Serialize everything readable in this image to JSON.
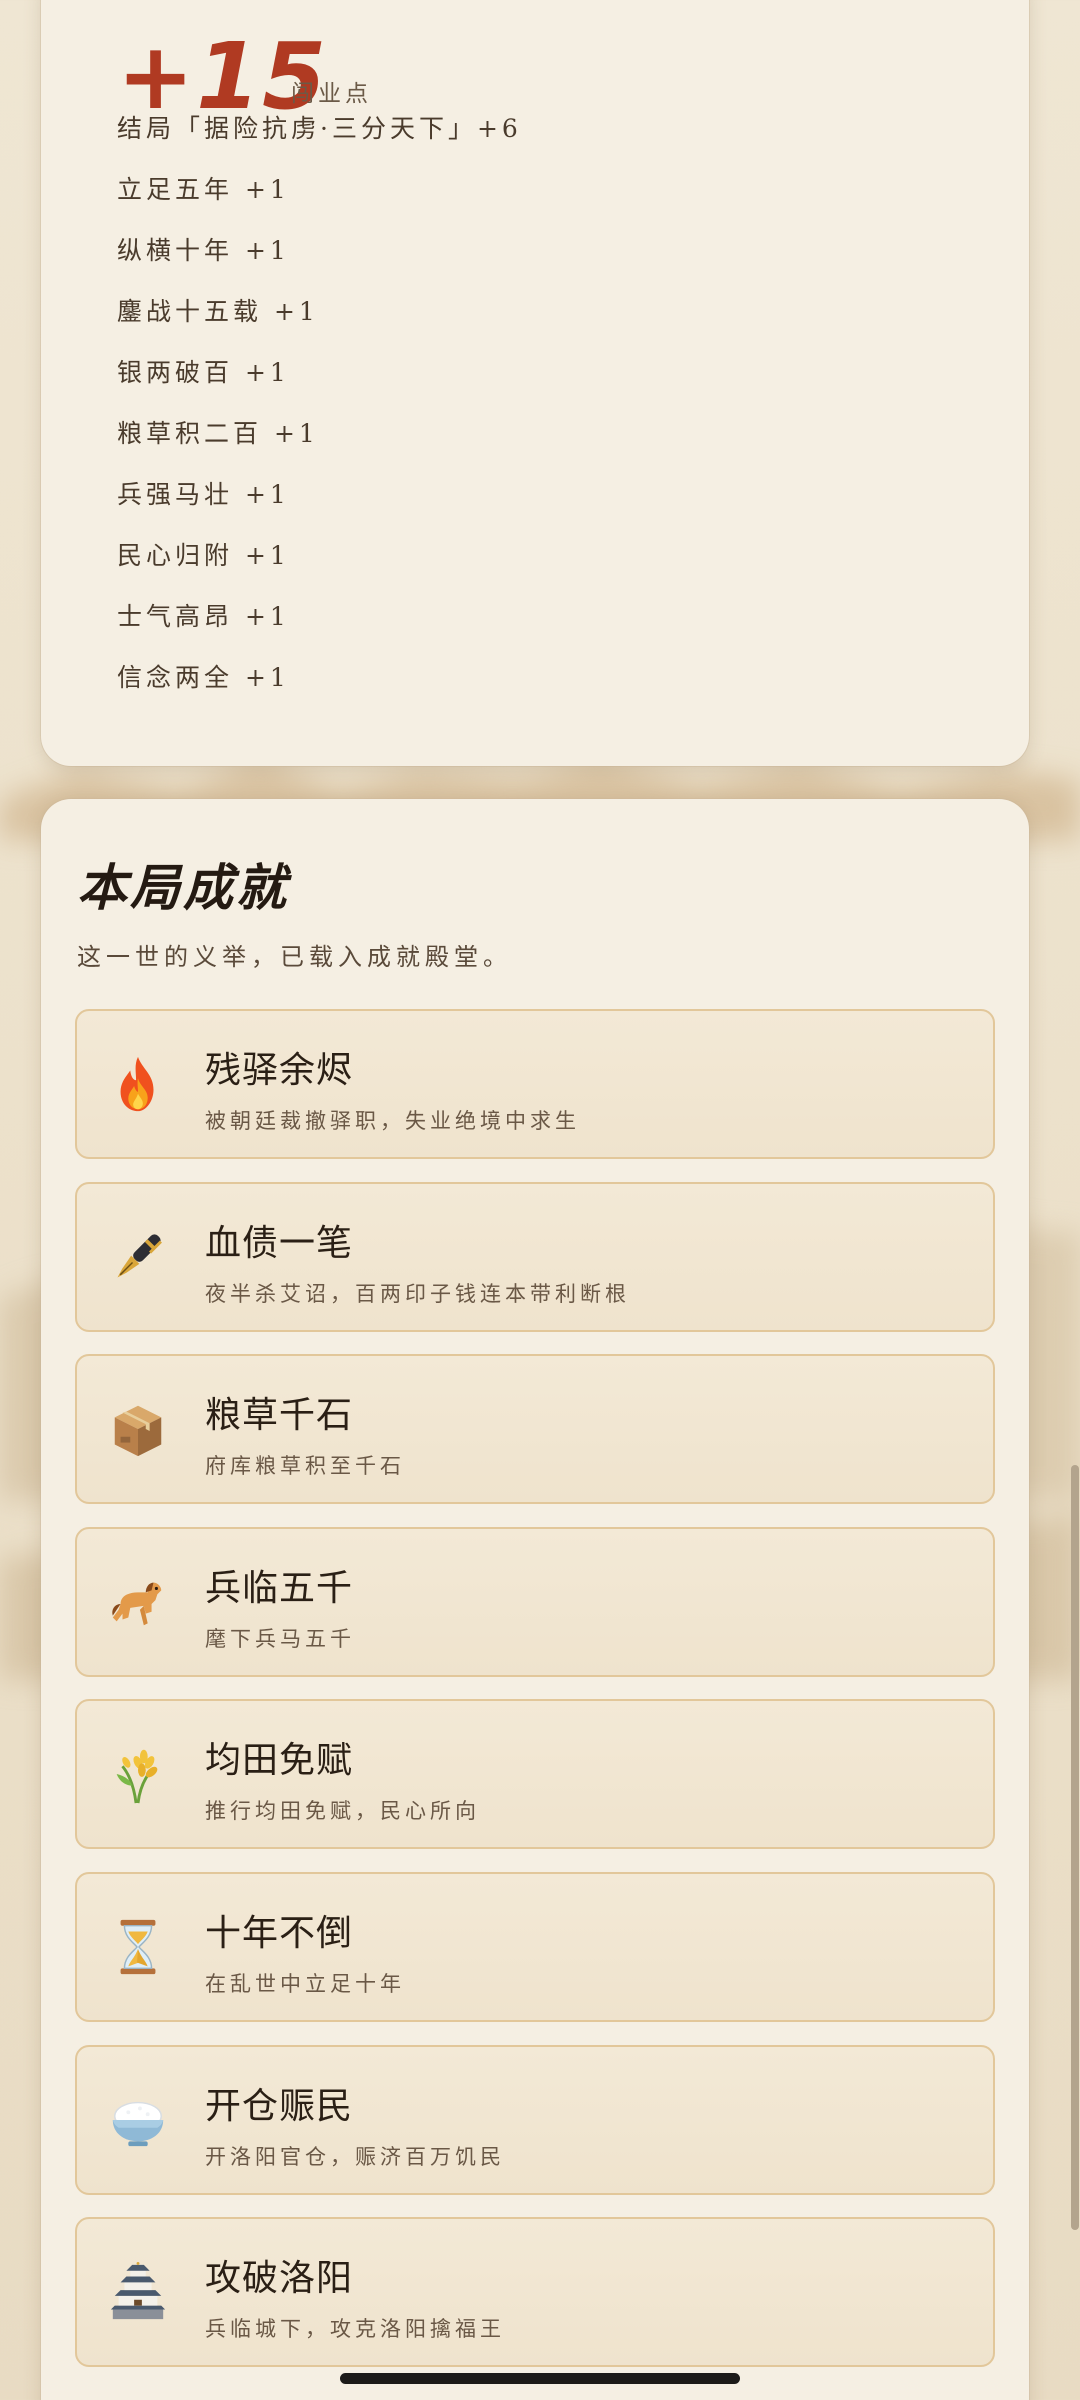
{
  "score": {
    "value": "+15",
    "label": "闯业点",
    "color": "#b03a22"
  },
  "bonuses": [
    "结局「据险抗虏·三分天下」+6",
    "立足五年 +1",
    "纵横十年 +1",
    "鏖战十五载 +1",
    "银两破百 +1",
    "粮草积二百 +1",
    "兵强马壮 +1",
    "民心归附 +1",
    "士气高昂 +1",
    "信念两全 +1"
  ],
  "achievements": {
    "title": "本局成就",
    "subtitle": "这一世的义举，已载入成就殿堂。",
    "items": [
      {
        "name": "残驿余烬",
        "desc": "被朝廷裁撤驿职，失业绝境中求生",
        "icon": "fire-icon"
      },
      {
        "name": "血债一笔",
        "desc": "夜半杀艾诏，百两印子钱连本带利断根",
        "icon": "pen-icon"
      },
      {
        "name": "粮草千石",
        "desc": "府库粮草积至千石",
        "icon": "box-icon"
      },
      {
        "name": "兵临五千",
        "desc": "麾下兵马五千",
        "icon": "horse-icon"
      },
      {
        "name": "均田免赋",
        "desc": "推行均田免赋，民心所向",
        "icon": "rice-icon"
      },
      {
        "name": "十年不倒",
        "desc": "在乱世中立足十年",
        "icon": "hourglass-icon"
      },
      {
        "name": "开仓赈民",
        "desc": "开洛阳官仓，赈济百万饥民",
        "icon": "rice-bowl-icon"
      },
      {
        "name": "攻破洛阳",
        "desc": "兵临城下，攻克洛阳擒福王",
        "icon": "castle-icon"
      }
    ]
  }
}
